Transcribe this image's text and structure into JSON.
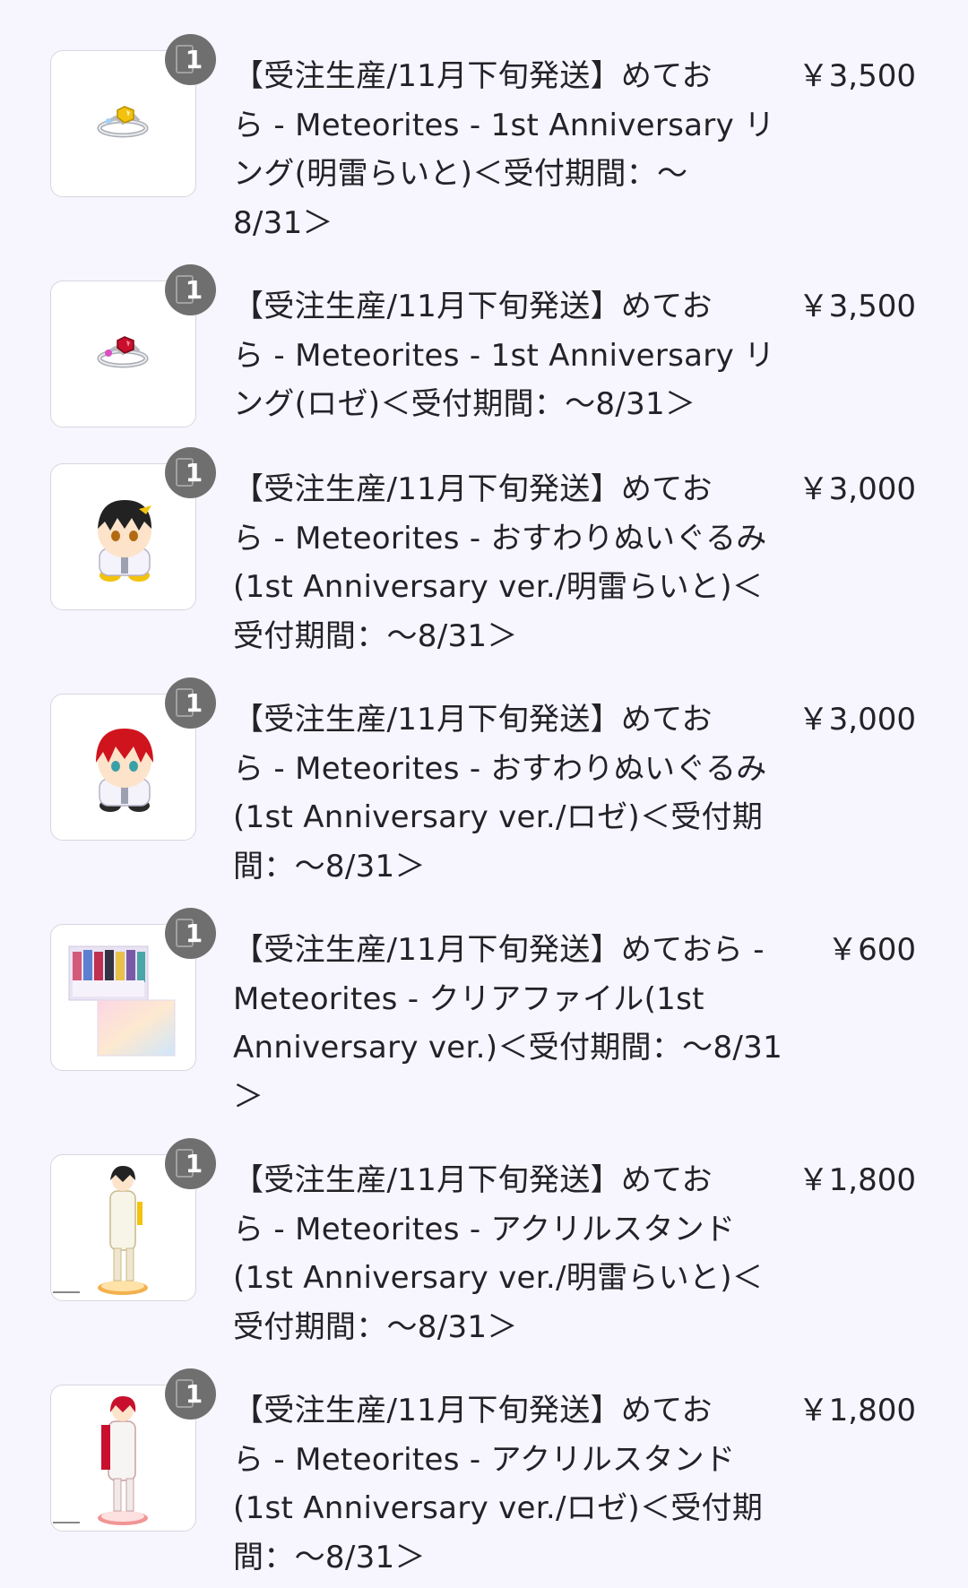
{
  "cart": {
    "items": [
      {
        "name_lines": [
          "【受注生産/11月下旬発送】めてお",
          "ら - Meteorites - 1st Anniversary リ",
          "ング(明雷らいと)＜受付期間：～",
          "8/31＞"
        ],
        "price": "￥3,500",
        "quantity": "1",
        "image_kind": "ring-icon",
        "gem_color": "#f2c20f"
      },
      {
        "name_lines": [
          "【受注生産/11月下旬発送】めてお",
          "ら - Meteorites - 1st Anniversary リ",
          "ング(ロゼ)＜受付期間：～8/31＞"
        ],
        "price": "￥3,500",
        "quantity": "1",
        "image_kind": "ring-icon",
        "gem_color": "#c8102e"
      },
      {
        "name_lines": [
          "【受注生産/11月下旬発送】めてお",
          "ら - Meteorites - おすわりぬいぐるみ",
          "(1st Anniversary ver./明雷らいと)＜",
          "受付期間：～8/31＞"
        ],
        "price": "￥3,000",
        "quantity": "1",
        "image_kind": "plush-icon",
        "hair_color": "#222222"
      },
      {
        "name_lines": [
          "【受注生産/11月下旬発送】めてお",
          "ら - Meteorites - おすわりぬいぐるみ",
          "(1st Anniversary ver./ロゼ)＜受付期",
          "間：～8/31＞"
        ],
        "price": "￥3,000",
        "quantity": "1",
        "image_kind": "plush-icon",
        "hair_color": "#d0141e"
      },
      {
        "name_lines": [
          "【受注生産/11月下旬発送】めておら -",
          "Meteorites - クリアファイル(1st",
          "Anniversary ver.)＜受付期間：～8/31",
          "＞"
        ],
        "price": "￥600",
        "quantity": "1",
        "image_kind": "clear-file-icon"
      },
      {
        "name_lines": [
          "【受注生産/11月下旬発送】めてお",
          "ら - Meteorites - アクリルスタンド",
          "(1st Anniversary ver./明雷らいと)＜",
          "受付期間：～8/31＞"
        ],
        "price": "￥1,800",
        "quantity": "1",
        "image_kind": "acrylic-stand-icon",
        "hair_color": "#222222",
        "base_color": "#f2a93b"
      },
      {
        "name_lines": [
          "【受注生産/11月下旬発送】めてお",
          "ら - Meteorites - アクリルスタンド",
          "(1st Anniversary ver./ロゼ)＜受付期",
          "間：～8/31＞"
        ],
        "price": "￥1,800",
        "quantity": "1",
        "image_kind": "acrylic-stand-icon",
        "hair_color": "#c8102e",
        "base_color": "#f08a8a"
      }
    ]
  }
}
